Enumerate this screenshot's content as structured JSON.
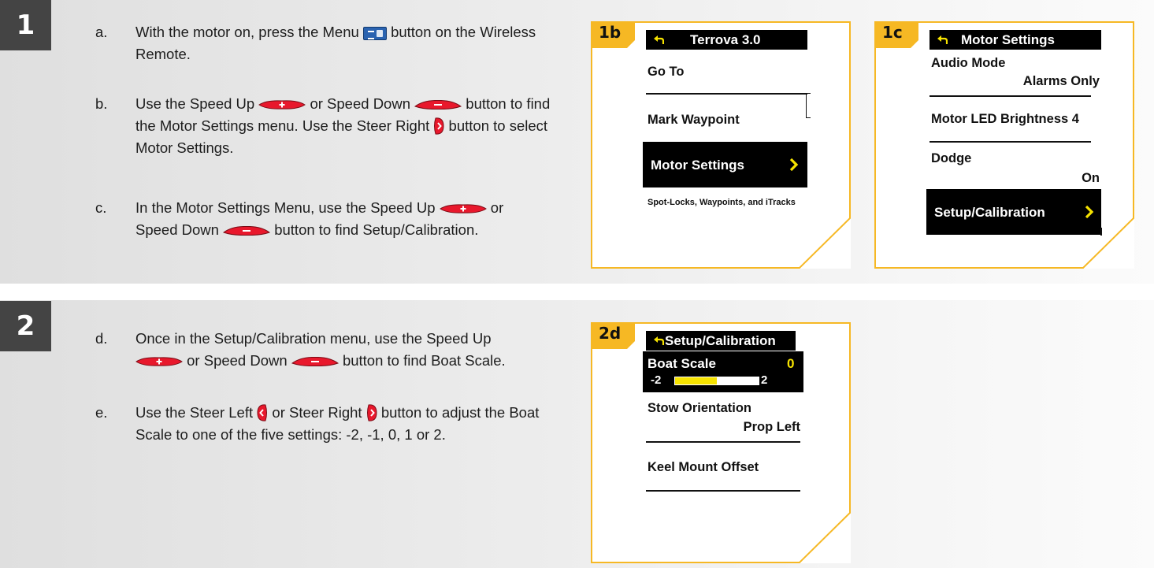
{
  "colors": {
    "accent": "#f6b824",
    "button_red": "#e8182c",
    "menu_blue": "#2a63b0",
    "step_badge": "#444444",
    "highlight_bar": "#f6e300"
  },
  "steps": [
    {
      "number": "1",
      "instructions": [
        {
          "letter": "a.",
          "before": "With the motor on, press the Menu ",
          "after": " button on the Wireless Remote."
        },
        {
          "letter": "b.",
          "part1": "Use the Speed Up ",
          "part2": " or Speed Down ",
          "part3": " button to find the Motor Settings menu. Use the Steer Right ",
          "part4": " button to select Motor Settings."
        },
        {
          "letter": "c.",
          "part1": "In the Motor Settings Menu, use the Speed Up ",
          "part2": " or Speed Down ",
          "part3": " button to find Setup/Calibration."
        }
      ]
    },
    {
      "number": "2",
      "instructions": [
        {
          "letter": "d.",
          "part1": "Once in the Setup/Calibration menu, use the Speed Up ",
          "part2": " or Speed Down ",
          "part3": " button to find Boat Scale."
        },
        {
          "letter": "e.",
          "part1": "Use the Steer Left ",
          "part2": " or Steer Right ",
          "part3": " button to adjust the Boat Scale to one of the five settings: -2, -1, 0, 1 or 2."
        }
      ]
    }
  ],
  "icons": {
    "menu": "menu-button-icon",
    "speed_up": "speed-up-button-icon",
    "speed_down": "speed-down-button-icon",
    "steer_right": "steer-right-button-icon",
    "steer_left": "steer-left-button-icon",
    "back": "back-arrow-icon",
    "select": "chevron-right-icon"
  },
  "panels": {
    "p1b": {
      "tag": "1b",
      "title": "Terrova 3.0",
      "items": [
        "Go To",
        "Mark Waypoint"
      ],
      "selected": "Motor Settings",
      "subtext": "Spot-Locks, Waypoints, and iTracks"
    },
    "p1c": {
      "tag": "1c",
      "title": "Motor Settings",
      "audio_label": "Audio Mode",
      "audio_value": "Alarms Only",
      "led_label": "Motor LED Brightness 4",
      "dodge_label": "Dodge",
      "dodge_value": "On",
      "selected": "Setup/Calibration"
    },
    "p2d": {
      "tag": "2d",
      "title": "Setup/Calibration",
      "boat_scale_label": "Boat Scale",
      "boat_scale_value": "0",
      "scale_min": "-2",
      "scale_max": "2",
      "scale_fill_fraction": 0.5,
      "stow_label": "Stow Orientation",
      "stow_value": "Prop Left",
      "keel_label": "Keel Mount Offset"
    }
  }
}
